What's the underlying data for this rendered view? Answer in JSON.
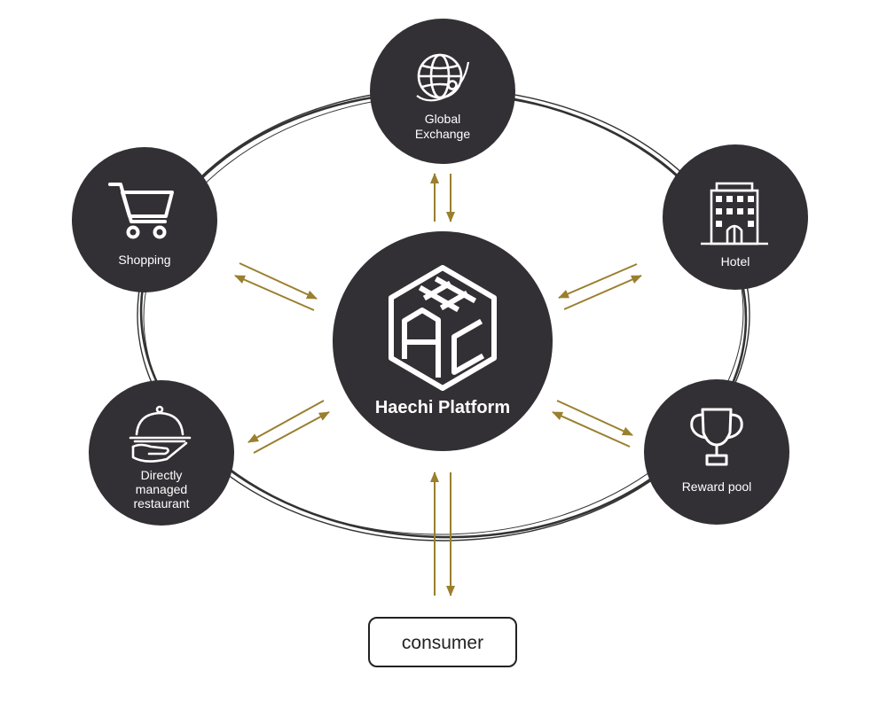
{
  "center": {
    "label": "Haechi Platform",
    "logo_text": "HAC",
    "icon": "haechi-cube-logo-icon"
  },
  "nodes": {
    "global_exchange": {
      "lines": [
        "Global",
        "Exchange"
      ],
      "icon": "globe-icon"
    },
    "shopping": {
      "lines": [
        "Shopping"
      ],
      "icon": "shopping-cart-icon"
    },
    "hotel": {
      "lines": [
        "Hotel"
      ],
      "icon": "hotel-building-icon"
    },
    "restaurant": {
      "lines": [
        "Directly",
        "managed",
        "restaurant"
      ],
      "icon": "serving-cloche-icon"
    },
    "reward_pool": {
      "lines": [
        "Reward pool"
      ],
      "icon": "trophy-icon"
    }
  },
  "consumer": {
    "label": "consumer"
  },
  "colors": {
    "node_fill": "#333035",
    "arrow": "#9a7f2e",
    "ring": "#333333",
    "consumer_border": "#222222"
  }
}
